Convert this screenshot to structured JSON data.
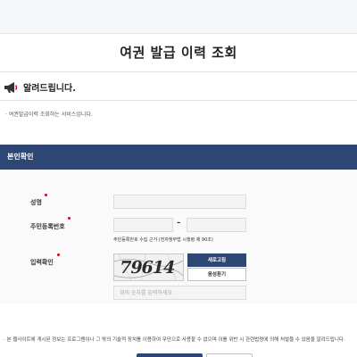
{
  "page": {
    "title": "여권 발급 이력 조회"
  },
  "notice": {
    "icon": "megaphone-icon",
    "title": "알려드립니다.",
    "items": [
      "여권발급이력 조회하는 서비스입니다."
    ]
  },
  "section": {
    "title": "본인확인"
  },
  "form": {
    "name": {
      "label": "성명",
      "value": ""
    },
    "rrn": {
      "label": "주민등록번호",
      "front_value": "",
      "back_value": "",
      "separator": "–",
      "hint": "주민등록번호 수집 근거 (전자정부법 시행령 제 90조)"
    },
    "captcha": {
      "label": "입력확인",
      "code": "79614",
      "refresh_label": "새로고침",
      "audio_label": "음성듣기",
      "input_placeholder": "위의 숫자를 입력하세요",
      "input_value": ""
    }
  },
  "footer": {
    "disclaimer": "본 웹사이트에 게시된 정보는 프로그램이나 그 밖의 기술적 장치를 이용하여 무단으로 사용할 수 없으며 이를 위반 시 관련법령에 의해 처벌을 수 있음을 알려드립니다."
  },
  "colors": {
    "primary": "#2c4773",
    "required": "#d0021b"
  }
}
